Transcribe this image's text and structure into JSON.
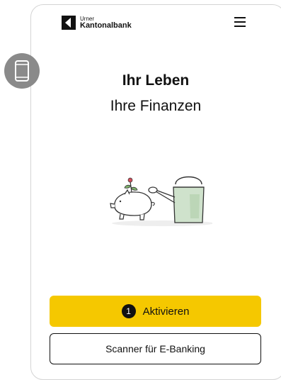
{
  "header": {
    "logo_line1": "Urner",
    "logo_line2": "Kantonalbank",
    "menu_icon": "hamburger-menu-icon"
  },
  "device_indicator": {
    "icon": "smartphone-icon"
  },
  "hero": {
    "title": "Ihr Leben",
    "subtitle": "Ihre Finanzen",
    "illustration": "piggy-bank-and-watering-can-illustration"
  },
  "actions": {
    "primary_label": "Aktivieren",
    "primary_badge": "1",
    "secondary_label": "Scanner für E-Banking"
  },
  "colors": {
    "accent": "#f5c800",
    "text": "#111111",
    "device_circle": "#8a8a8a",
    "frame_border": "#d4d4d4"
  }
}
